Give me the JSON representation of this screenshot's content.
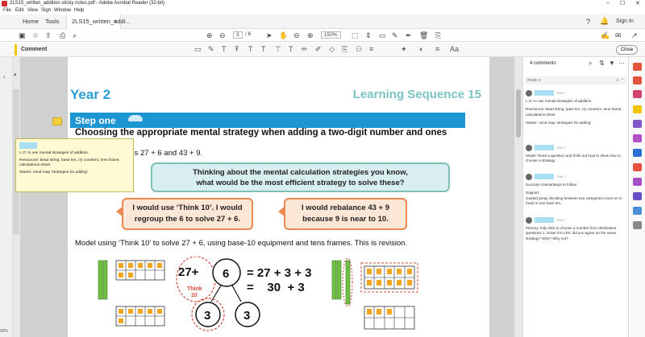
{
  "window": {
    "title": "2LS15_written_addition sticky notes.pdf - Adobe Acrobat Reader (32-bit)"
  },
  "menu": [
    "File",
    "Edit",
    "View",
    "Sign",
    "Window",
    "Help"
  ],
  "tabs": {
    "home": "Home",
    "tools": "Tools",
    "document": "2LS15_written_addi..."
  },
  "header": {
    "sign_in": "Sign In"
  },
  "toolbar": {
    "page_current": "3",
    "page_total": "/ 6",
    "zoom": "150%"
  },
  "comment_bar": {
    "label": "Comment",
    "close": "Close"
  },
  "page": {
    "year": "Year 2",
    "sequence": "Learning Sequence 15",
    "step": "Step one",
    "heading": "Choosing the appropriate mental strategy when adding a two-digit number and ones",
    "calculations": "ations 27 + 6 and 43 + 9.",
    "question_line1": "Thinking about the mental calculation strategies you know,",
    "question_line2": "what would be the most efficient strategy to solve these?",
    "answer1_line1": "I would use ‘Think 10’. I would",
    "answer1_line2": "regroup the 6 to solve 27 + 6.",
    "answer2_line1": "I would rebalance 43 + 9",
    "answer2_line2": "because 9 is near to 10.",
    "model": "Model using ‘Think 10’ to solve 27 + 6, using base-10 equipment and tens frames. This is revision.",
    "eq_left": "27+",
    "eq_circle_top": "6",
    "eq_think": "Think",
    "eq_ten": "10",
    "eq_circle_a": "3",
    "eq_circle_b": "3",
    "eq_line1": "= 27 + 3 + 3",
    "eq_line2": "=    30  + 3"
  },
  "popup": {
    "lines": [
      "L.O: to use mental strategies of addition.",
      "Resources: bead string, base ten, r/y counters, tens frame, calculations sheet",
      "Starter: mind map 'strategies for adding'"
    ]
  },
  "comments_panel": {
    "count": "4 comments",
    "page_label": "PAGE 3",
    "page_count": "4",
    "comments": [
      {
        "date": "Feb 7",
        "paras": [
          "L.O: to use mental strategies of addition.",
          "Resources: bead string, base ten, r/y counters, tens frame, calculations sheet",
          "Starter: mind map 'strategies for adding'"
        ]
      },
      {
        "date": "Feb 7",
        "paras": [
          "Model: Read a question and think out loud to show how to choose a strategy."
        ]
      },
      {
        "date": "Feb 7",
        "paras": [
          "Success criteria/steps to follow:",
          "Support:\nGuided group deciding between two categories count on in head or use base ten."
        ]
      },
      {
        "date": "Feb 7",
        "paras": [
          "Plenary: lolly stick to choose a number from destination questions 1. Solve it in LPs: did you agree on the same strategy? Why? Why not?"
        ]
      }
    ]
  },
  "status": {
    "zoom": "00%"
  },
  "colors": {
    "accent_blue": "#1c95d3",
    "title_blue": "#2a9fd6",
    "teal": "#7cc4c0",
    "orange": "#e98a52",
    "sticky": "#f5d23b"
  }
}
